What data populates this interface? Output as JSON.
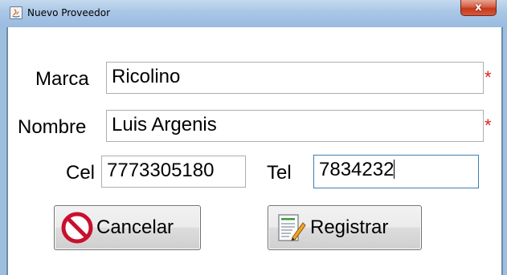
{
  "window": {
    "title": "Nuevo Proveedor",
    "close_glyph": "x",
    "app_icon": "java-app-icon"
  },
  "form": {
    "marca": {
      "label": "Marca",
      "value": "Ricolino",
      "required_mark": "*"
    },
    "nombre": {
      "label": "Nombre",
      "value": "Luis Argenis",
      "required_mark": "*"
    },
    "cel": {
      "label": "Cel",
      "value": "7773305180"
    },
    "tel": {
      "label": "Tel",
      "value": "7834232"
    }
  },
  "buttons": {
    "cancel": {
      "label": "Cancelar",
      "icon": "no-entry-icon"
    },
    "register": {
      "label": "Registrar",
      "icon": "edit-document-icon"
    }
  },
  "colors": {
    "required": "#e02020",
    "cancel_icon": "#c8102e",
    "active_border": "#3c7fb1"
  }
}
